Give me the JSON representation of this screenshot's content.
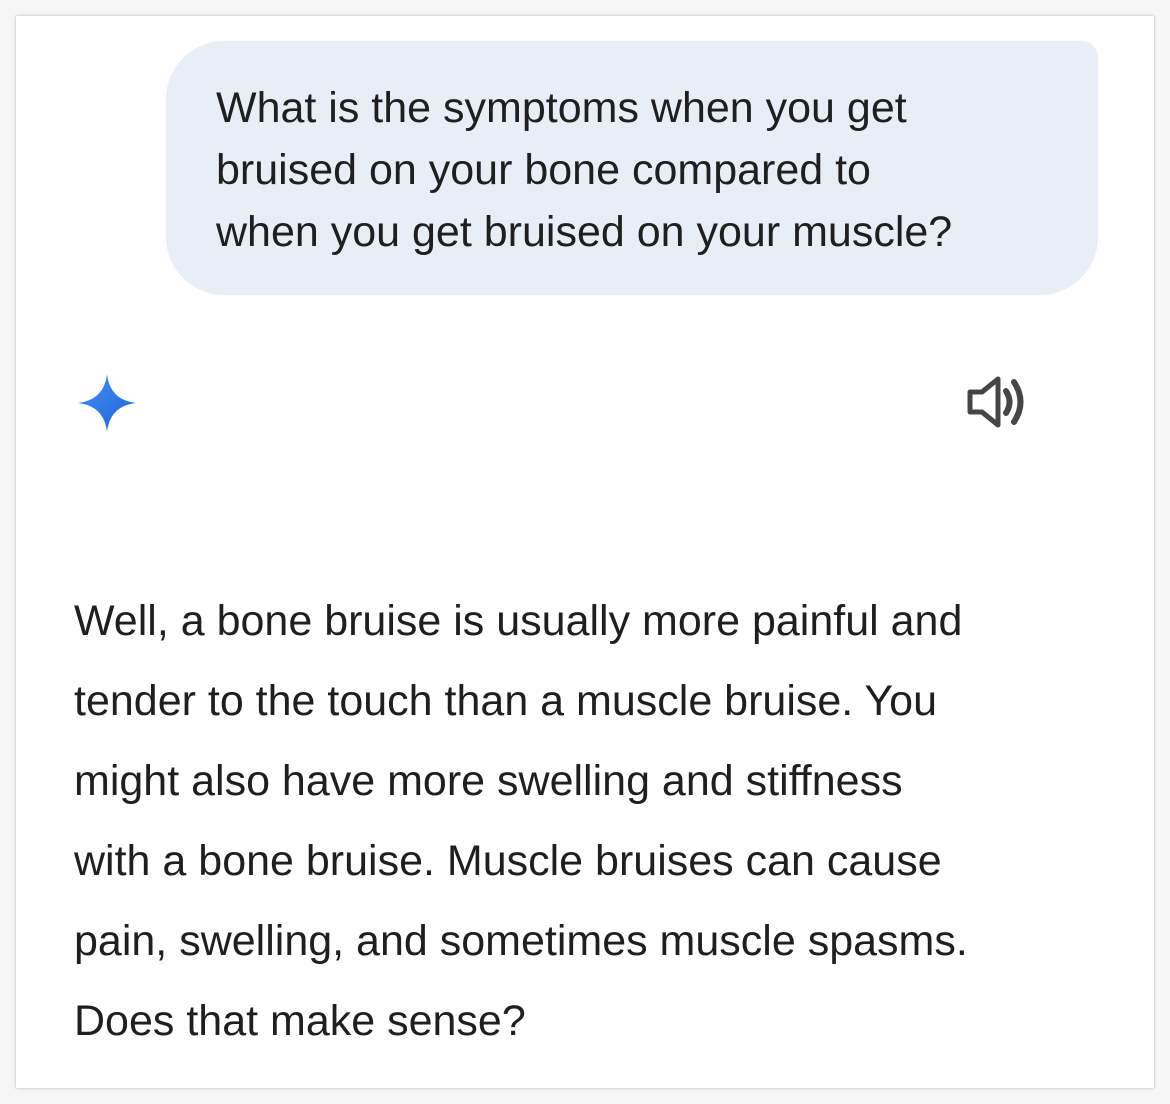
{
  "user_message": {
    "lines": [
      "What is the symptoms when you get",
      "bruised on your bone compared to",
      "when you get bruised on your muscle?"
    ]
  },
  "assistant": {
    "icon": "gemini-sparkle-icon",
    "speaker_icon": "speaker-icon",
    "accent_colors": [
      "#4285f4",
      "#1a73e8"
    ],
    "response_lines": [
      "Well, a bone bruise is usually more painful and",
      "tender to the touch than a muscle bruise. You",
      "might also have more swelling and stiffness",
      "with a bone bruise. Muscle bruises can cause",
      "pain, swelling, and sometimes muscle spasms.",
      "Does that make sense?"
    ]
  }
}
